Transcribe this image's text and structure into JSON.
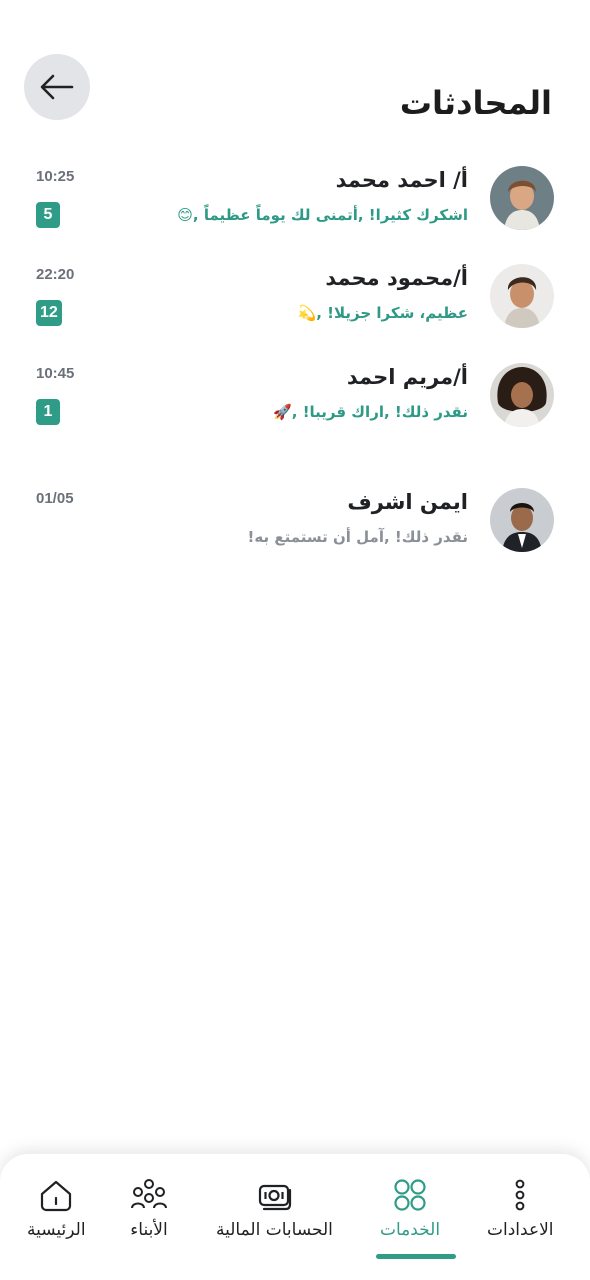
{
  "header": {
    "title": "المحادثات"
  },
  "colors": {
    "accent": "#2f9c88",
    "unread_text": "#2e9a86",
    "read_text": "#8a8f98"
  },
  "chats": [
    {
      "name": "أ/ احمد محمد",
      "message": "اشكرك كثيرا! ,أتمنى لك يوماً عظيماً ,😊",
      "time": "10:25",
      "badge": "5",
      "unread": true
    },
    {
      "name": "أ/محمود محمد",
      "message": "عظيم، شكرا جزيلا! ,💫",
      "time": "22:20",
      "badge": "12",
      "unread": true
    },
    {
      "name": "أ/مريم احمد",
      "message": "نقدر ذلك! ,اراك قريبا! ,🚀",
      "time": "10:45",
      "badge": "1",
      "unread": true
    },
    {
      "name": "ايمن اشرف",
      "message": "نقدر ذلك! ,آمل أن تستمتع به!",
      "time": "01/05",
      "badge": "",
      "unread": false
    }
  ],
  "nav": {
    "settings": "الاعدادات",
    "services": "الخدمات",
    "accounts": "الحسابات المالية",
    "children": "الأبناء",
    "home": "الرئيسية"
  }
}
